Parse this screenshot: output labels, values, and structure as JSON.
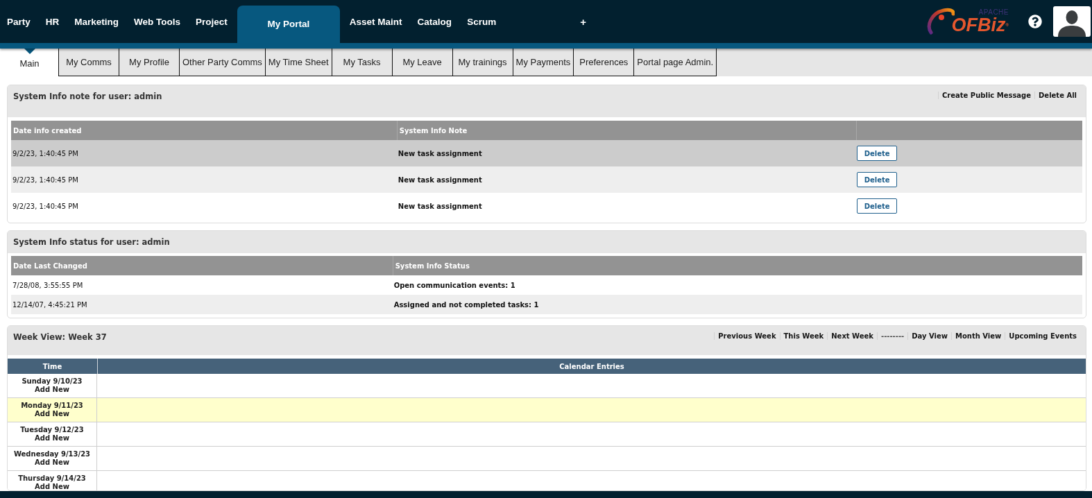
{
  "top_nav": {
    "items": [
      {
        "label": "Party",
        "selected": false
      },
      {
        "label": "HR",
        "selected": false
      },
      {
        "label": "Marketing",
        "selected": false
      },
      {
        "label": "Web Tools",
        "selected": false
      },
      {
        "label": "Project",
        "selected": false
      },
      {
        "label": "My Portal",
        "selected": true
      },
      {
        "label": "Asset Maint",
        "selected": false
      },
      {
        "label": "Catalog",
        "selected": false
      },
      {
        "label": "Scrum",
        "selected": false
      }
    ],
    "add_label": "+"
  },
  "logo": {
    "small": "APACHE",
    "name": "OFBiz$^{®}$"
  },
  "tabs": [
    {
      "label": "Main",
      "selected": true
    },
    {
      "label": "My Comms",
      "selected": false
    },
    {
      "label": "My Profile",
      "selected": false
    },
    {
      "label": "Other Party Comms",
      "selected": false
    },
    {
      "label": "My Time Sheet",
      "selected": false
    },
    {
      "label": "My Tasks",
      "selected": false
    },
    {
      "label": "My Leave",
      "selected": false
    },
    {
      "label": "My trainings",
      "selected": false
    },
    {
      "label": "My Payments",
      "selected": false
    },
    {
      "label": "Preferences",
      "selected": false
    },
    {
      "label": "Portal page Admin.",
      "selected": false
    }
  ],
  "note_panel": {
    "title": "System Info note for user: admin",
    "links": [
      {
        "label": "Create Public Message",
        "kind": "link"
      },
      {
        "label": "Delete All",
        "kind": "link"
      }
    ],
    "columns": [
      "Date info created",
      "System Info Note"
    ],
    "rows": [
      {
        "date": "9/2/23, 1:40:45 PM",
        "note": "New task assignment",
        "action": "Delete",
        "highlighted": true
      },
      {
        "date": "9/2/23, 1:40:45 PM",
        "note": "New task assignment",
        "action": "Delete",
        "highlighted": false
      },
      {
        "date": "9/2/23, 1:40:45 PM",
        "note": "New task assignment",
        "action": "Delete",
        "highlighted": false
      }
    ]
  },
  "status_panel": {
    "title": "System Info status for user: admin",
    "columns": [
      "Date Last Changed",
      "System Info Status"
    ],
    "rows": [
      {
        "date": "7/28/08, 3:55:55 PM",
        "status": "Open communication events: 1"
      },
      {
        "date": "12/14/07, 4:45:21 PM",
        "status": "Assigned and not completed tasks: 1"
      }
    ]
  },
  "week_view": {
    "title": "Week View: Week 37",
    "links": [
      {
        "label": "Previous Week",
        "kind": "link"
      },
      {
        "label": "This Week",
        "kind": "link"
      },
      {
        "label": "Next Week",
        "kind": "link"
      },
      {
        "label": "--------",
        "kind": "separator"
      },
      {
        "label": "Day View",
        "kind": "link"
      },
      {
        "label": "Month View",
        "kind": "link"
      },
      {
        "label": "Upcoming Events",
        "kind": "link"
      }
    ],
    "columns": [
      "Time",
      "Calendar Entries"
    ],
    "days": [
      {
        "label": "Sunday 9/10/23",
        "action": "Add New",
        "today": false
      },
      {
        "label": "Monday 9/11/23",
        "action": "Add New",
        "today": true
      },
      {
        "label": "Tuesday 9/12/23",
        "action": "Add New",
        "today": false
      },
      {
        "label": "Wednesday 9/13/23",
        "action": "Add New",
        "today": false
      },
      {
        "label": "Thursday 9/14/23",
        "action": "Add New",
        "today": false
      }
    ]
  }
}
